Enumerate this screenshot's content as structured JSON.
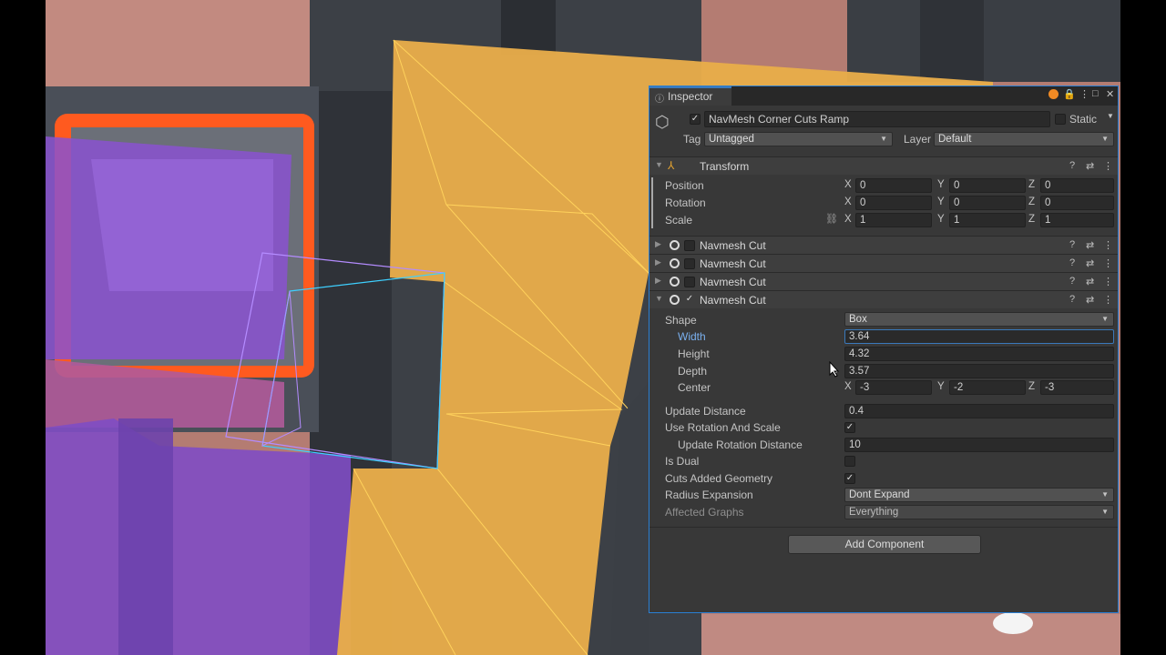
{
  "inspector": {
    "tab_label": "Inspector",
    "object_name": "NavMesh Corner Cuts Ramp",
    "static_label": "Static",
    "tag_label": "Tag",
    "tag_value": "Untagged",
    "layer_label": "Layer",
    "layer_value": "Default",
    "transform": {
      "title": "Transform",
      "position_label": "Position",
      "rotation_label": "Rotation",
      "scale_label": "Scale",
      "position": {
        "x": "0",
        "y": "0",
        "z": "0"
      },
      "rotation": {
        "x": "0",
        "y": "0",
        "z": "0"
      },
      "scale": {
        "x": "1",
        "y": "1",
        "z": "1"
      }
    },
    "axis": {
      "x": "X",
      "y": "Y",
      "z": "Z"
    },
    "components": [
      {
        "title": "Navmesh Cut",
        "enabled": false,
        "expanded": false
      },
      {
        "title": "Navmesh Cut",
        "enabled": false,
        "expanded": false
      },
      {
        "title": "Navmesh Cut",
        "enabled": false,
        "expanded": false
      },
      {
        "title": "Navmesh Cut",
        "enabled": true,
        "expanded": true
      }
    ],
    "navmesh_cut": {
      "shape_label": "Shape",
      "shape_value": "Box",
      "width_label": "Width",
      "width_value": "3.64",
      "height_label": "Height",
      "height_value": "4.32",
      "depth_label": "Depth",
      "depth_value": "3.57",
      "center_label": "Center",
      "center": {
        "x": "-3",
        "y": "-2",
        "z": "-3"
      },
      "update_distance_label": "Update Distance",
      "update_distance_value": "0.4",
      "use_rotation_label": "Use Rotation And Scale",
      "update_rotation_distance_label": "Update Rotation Distance",
      "update_rotation_distance_value": "10",
      "is_dual_label": "Is Dual",
      "cuts_added_geometry_label": "Cuts Added Geometry",
      "radius_expansion_label": "Radius Expansion",
      "radius_expansion_value": "Dont Expand",
      "affected_graphs_label": "Affected Graphs",
      "affected_graphs_value": "Everything"
    },
    "add_component_label": "Add Component",
    "check_glyph": "✓"
  },
  "colors": {
    "navmesh_yellow": "#e8ad4a",
    "navmesh_purple": "#8a52d0",
    "highlight_orange": "#ff5a1f",
    "accent_blue": "#3a79bb"
  }
}
